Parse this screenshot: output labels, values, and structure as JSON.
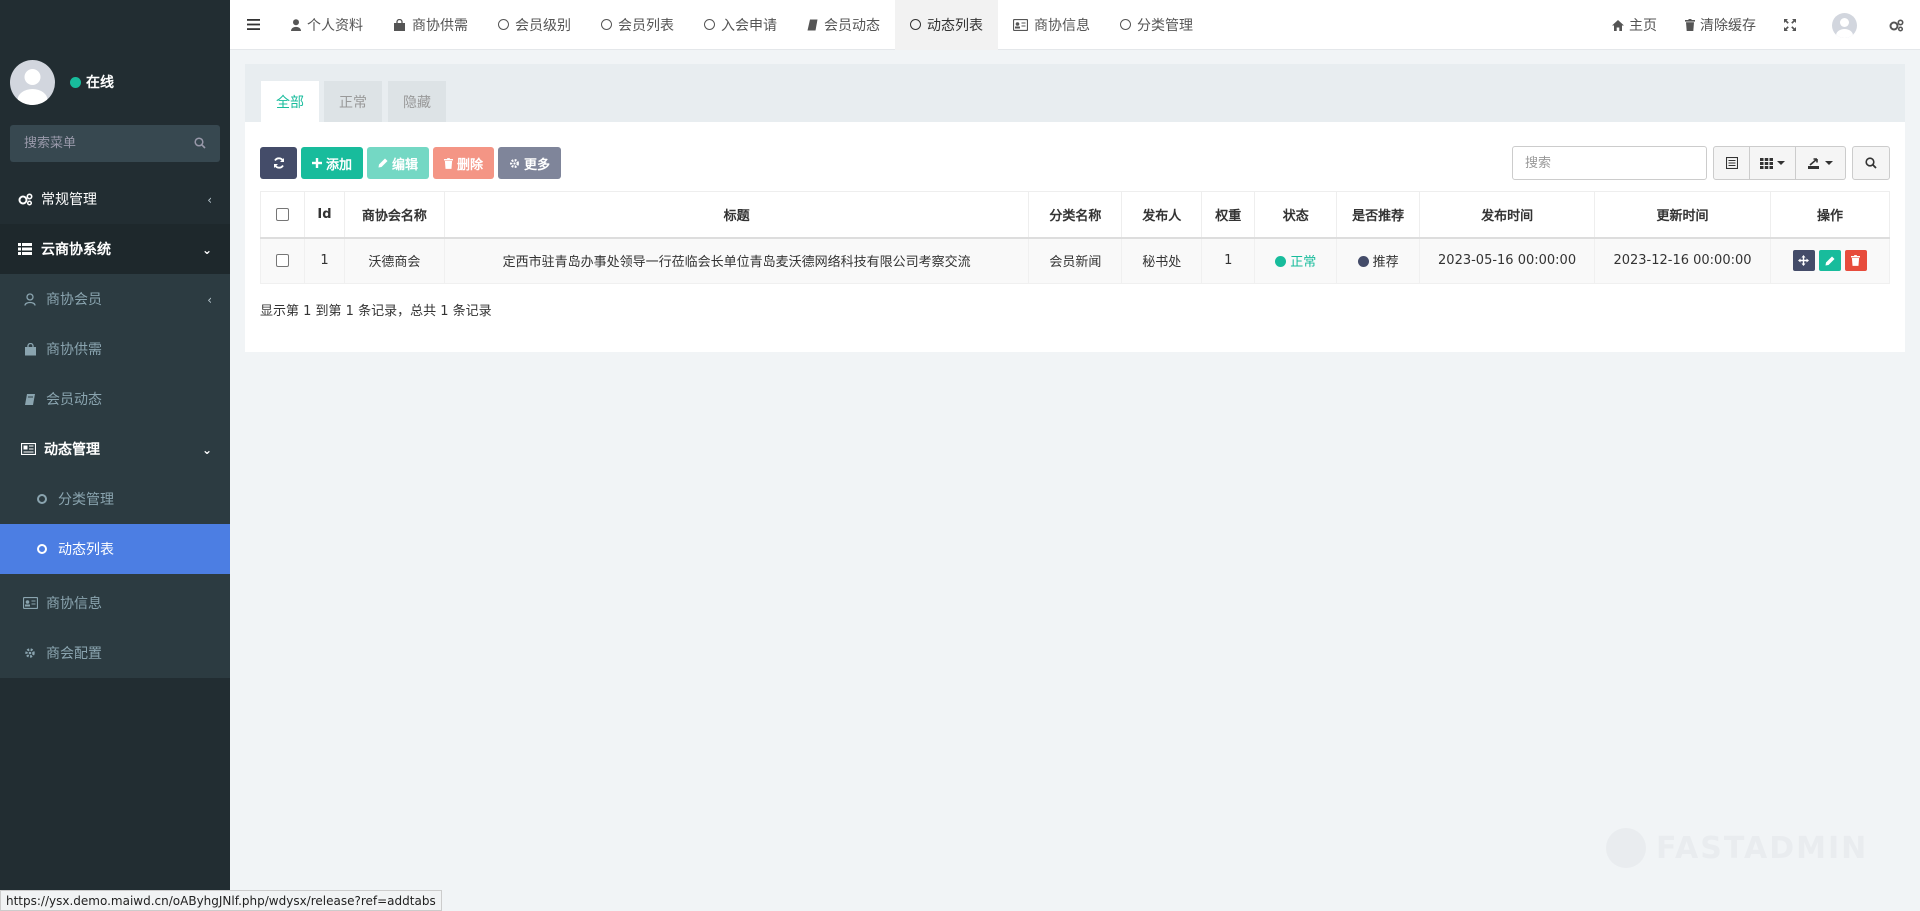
{
  "sidebar": {
    "user_status": "在线",
    "search_placeholder": "搜索菜单",
    "menu": {
      "general": "常规管理",
      "cloud_system": "云商协系统",
      "members": "商协会员",
      "supply": "商协供需",
      "member_news": "会员动态",
      "news_manage": "动态管理",
      "category_manage": "分类管理",
      "news_list": "动态列表",
      "chamber_info": "商协信息",
      "chamber_config": "商会配置"
    }
  },
  "topbar": {
    "tabs": [
      "个人资料",
      "商协供需",
      "会员级别",
      "会员列表",
      "入会申请",
      "会员动态",
      "动态列表",
      "商协信息",
      "分类管理"
    ],
    "home": "主页",
    "clear_cache": "清除缓存"
  },
  "panel": {
    "tabs": [
      "全部",
      "正常",
      "隐藏"
    ],
    "toolbar": {
      "add": "添加",
      "edit": "编辑",
      "delete": "删除",
      "more": "更多"
    },
    "search_placeholder": "搜索",
    "columns": [
      "Id",
      "商协会名称",
      "标题",
      "分类名称",
      "发布人",
      "权重",
      "状态",
      "是否推荐",
      "发布时间",
      "更新时间",
      "操作"
    ],
    "rows": [
      {
        "id": "1",
        "chamber": "沃德商会",
        "title": "定西市驻青岛办事处领导一行莅临会长单位青岛麦沃德网络科技有限公司考察交流",
        "category": "会员新闻",
        "publisher": "秘书处",
        "weight": "1",
        "status": "正常",
        "recommend": "推荐",
        "publish_time": "2023-05-16 00:00:00",
        "update_time": "2023-12-16 00:00:00"
      }
    ],
    "page_info": "显示第 1 到第 1 条记录，总共 1 条记录"
  },
  "watermark": "FASTADMIN",
  "status_url": "https://ysx.demo.maiwd.cn/oAByhgJNlf.php/wdysx/release?ref=addtabs",
  "colors": {
    "sidebar_bg": "#222d32",
    "active_menu": "#4c7ee3",
    "success": "#18bc9c",
    "danger": "#e74c3c",
    "dark": "#444c69"
  }
}
